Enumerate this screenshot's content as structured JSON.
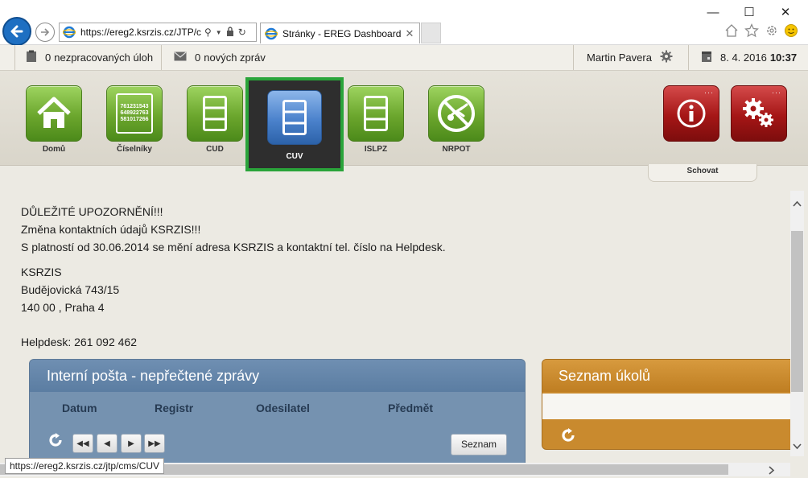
{
  "browser": {
    "url": "https://ereg2.ksrzis.cz/JTP/cı",
    "tab_title": "Stránky - EREG Dashboard",
    "tab_close": "✕",
    "status_url": "https://ereg2.ksrzis.cz/jtp/cms/CUV",
    "minimize": "—",
    "maximize": "☐",
    "close": "✕"
  },
  "topbar": {
    "tasks_count": "0",
    "tasks_label": "nezpracovaných úloh",
    "messages_count": "0",
    "messages_label": "nových zpráv",
    "user_name": "Martin Pavera",
    "date": "8. 4. 2016",
    "time": "10:37"
  },
  "menu": {
    "tiles": [
      {
        "label": "Domů",
        "icon": "home-icon"
      },
      {
        "label": "Číselníky",
        "icon": "codelist-icon",
        "numbers": [
          "761231543",
          "648922763",
          "581017266"
        ]
      },
      {
        "label": "CUD",
        "icon": "list-icon"
      },
      {
        "label": "CUV",
        "icon": "list-icon",
        "selected": true
      },
      {
        "label": "ISLPZ",
        "icon": "list-icon"
      },
      {
        "label": "NRPOT",
        "icon": "injury-icon"
      }
    ],
    "right_tiles": [
      {
        "icon": "info-icon",
        "dots": "···"
      },
      {
        "icon": "settings-gears-icon",
        "dots": "···"
      }
    ],
    "hide_label": "Schovat"
  },
  "notice": {
    "line1": "DŮLEŽITÉ UPOZORNĚNÍ!!!",
    "line2": "Změna kontaktních údajů KSRZIS!!!",
    "line3": "S platností od 30.06.2014 se mění adresa KSRZIS a kontaktní tel. číslo na Helpdesk.",
    "org": "KSRZIS",
    "street": "Budějovická 743/15",
    "city": "140 00 , Praha 4",
    "helpdesk": "Helpdesk: 261 092 462"
  },
  "mail_panel": {
    "title": "Interní pošta - nepřečtené zprávy",
    "columns": [
      "Datum",
      "Registr",
      "Odesilatel",
      "Předmět"
    ],
    "list_button": "Seznam"
  },
  "tasks_panel": {
    "title": "Seznam úkolů"
  },
  "colors": {
    "accent_green": "#2aa43a",
    "tile_green": "#6ba62d",
    "tile_blue": "#4b82cc",
    "tile_red": "#a51616",
    "mail_panel": "#7592b0",
    "tasks_panel": "#c98a2e"
  }
}
